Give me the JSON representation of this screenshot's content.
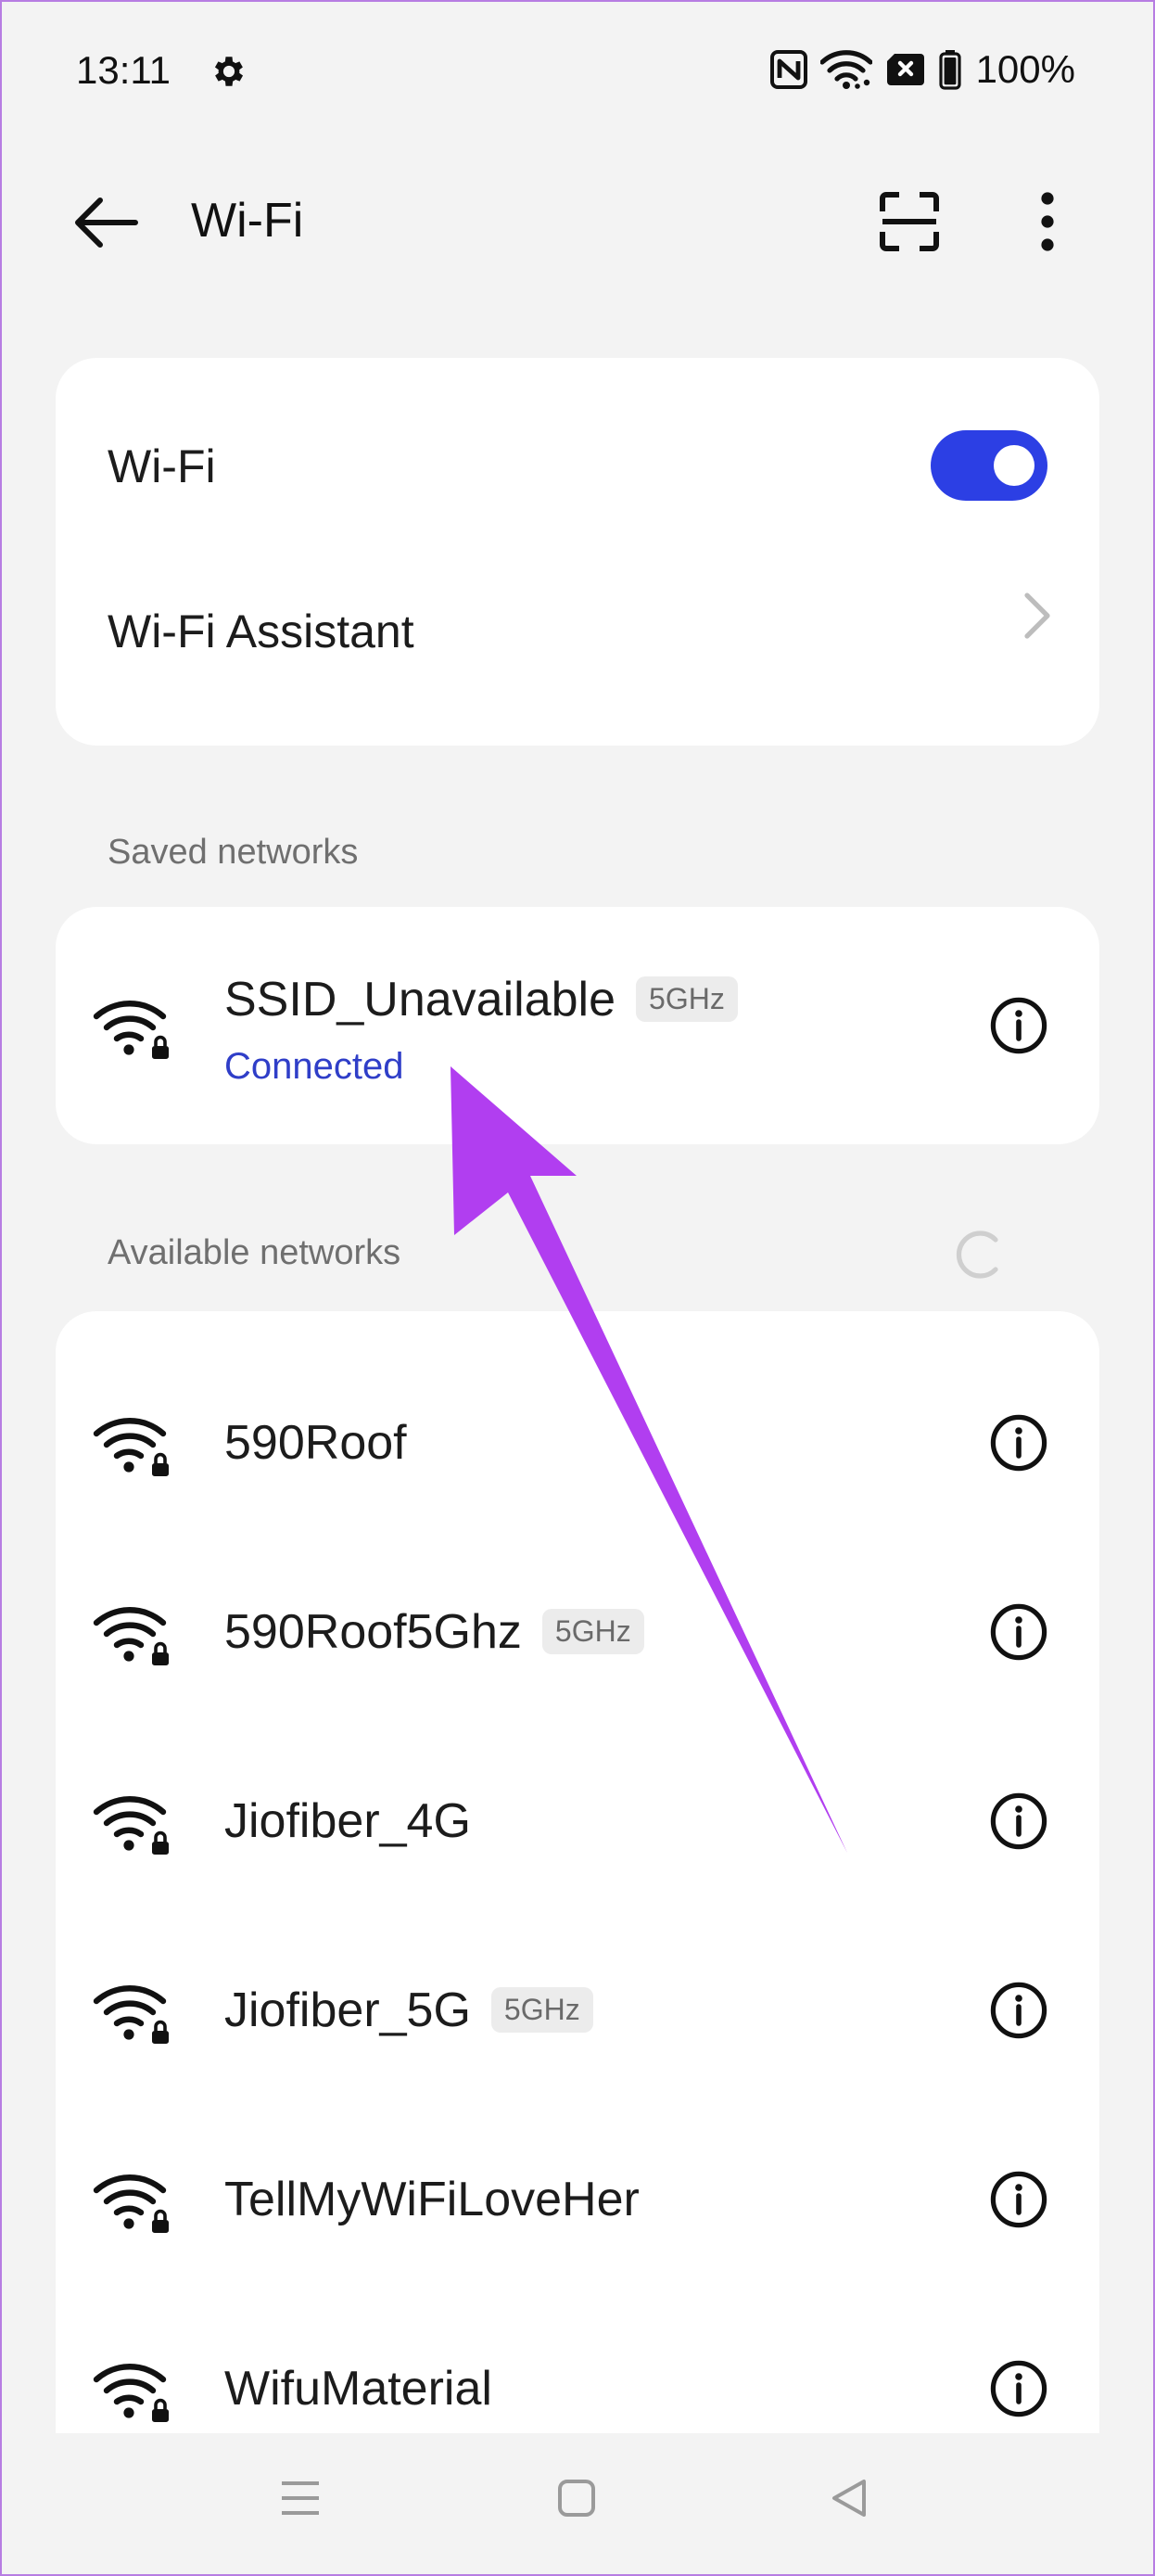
{
  "status_bar": {
    "time": "13:11",
    "battery": "100%",
    "icons": [
      "gear-icon",
      "nfc-icon",
      "wifi-icon",
      "sim-error-icon",
      "battery-icon"
    ]
  },
  "app_bar": {
    "title": "Wi-Fi",
    "icons": [
      "back-arrow-icon",
      "scan-icon",
      "more-vert-icon"
    ]
  },
  "settings": {
    "wifi_label": "Wi-Fi",
    "wifi_enabled": true,
    "assistant_label": "Wi-Fi Assistant"
  },
  "saved_networks": {
    "header": "Saved networks",
    "items": [
      {
        "name": "SSID_Unavailable",
        "band": "5GHz",
        "status": "Connected"
      }
    ]
  },
  "available_networks": {
    "header": "Available networks",
    "items": [
      {
        "name": "590Roof",
        "band": ""
      },
      {
        "name": "590Roof5Ghz",
        "band": "5GHz"
      },
      {
        "name": "Jiofiber_4G",
        "band": ""
      },
      {
        "name": "Jiofiber_5G",
        "band": "5GHz"
      },
      {
        "name": "TellMyWiFiLoveHer",
        "band": ""
      },
      {
        "name": "WifuMaterial",
        "band": ""
      }
    ]
  },
  "colors": {
    "accent": "#2c3fe4",
    "connected_text": "#2f3ec8",
    "annotation_arrow": "#b13ef0"
  },
  "nav_bar": {
    "icons": [
      "menu-icon",
      "home-square-icon",
      "back-triangle-icon"
    ]
  }
}
